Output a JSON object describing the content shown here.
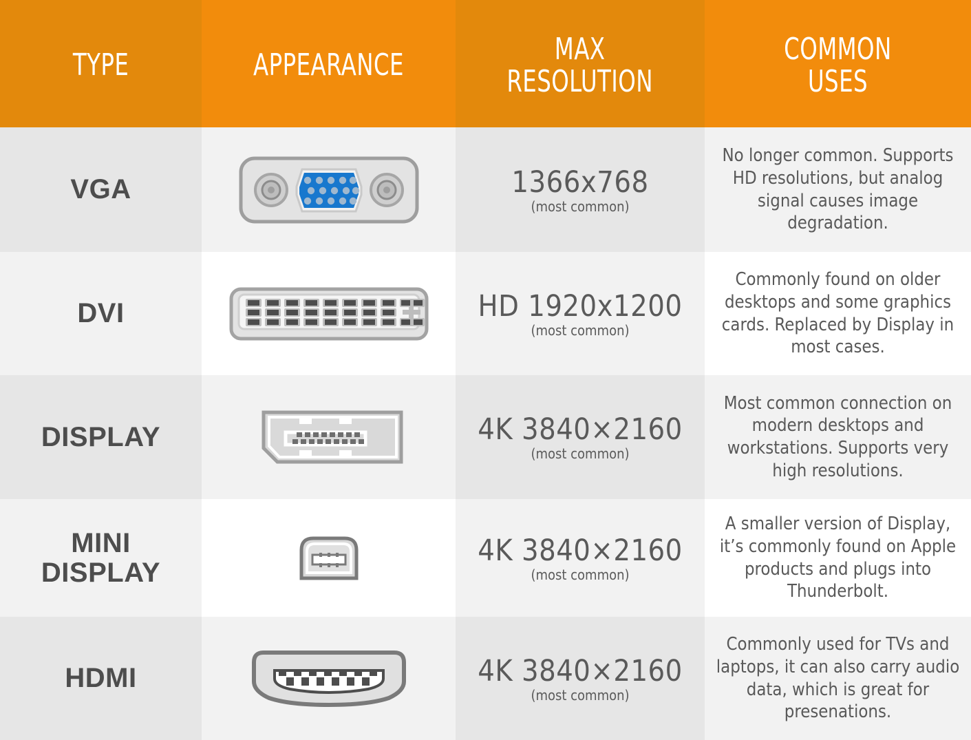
{
  "header": {
    "columns": [
      {
        "label": "TYPE",
        "shade": "dark"
      },
      {
        "label": "APPEARANCE",
        "shade": "bright"
      },
      {
        "label_line1": "MAX",
        "label_line2": "RESOLUTION",
        "shade": "dark"
      },
      {
        "label_line1": "COMMON",
        "label_line2": "USES",
        "shade": "bright"
      }
    ]
  },
  "colors": {
    "header_orange_dark": "#E3890C",
    "header_orange_bright": "#F28C0C",
    "row_shade_a": "#E6E6E6",
    "row_shade_b": "#F2F2F2",
    "row_shade_c": "#FFFFFF",
    "text_gray": "#595959",
    "type_gray": "#4D4D4D",
    "connector_body": "#E0E0E0",
    "connector_outline": "#9A9A9A",
    "connector_pin": "#4D4D4D",
    "vga_blue": "#1878CE"
  },
  "rows": [
    {
      "type": "VGA",
      "connector": "vga-connector",
      "resolution": "1366x768",
      "resolution_note": "(most common)",
      "uses": "No longer common. Supports HD resolutions, but analog signal causes image degradation."
    },
    {
      "type": "DVI",
      "connector": "dvi-connector",
      "resolution": "HD  1920x1200",
      "resolution_note": "(most common)",
      "uses": "Commonly found on older desktops and some graphics cards. Replaced by Display in most cases."
    },
    {
      "type": "DISPLAY",
      "connector": "displayport-connector",
      "resolution": "4K 3840×2160",
      "resolution_note": "(most common)",
      "uses": "Most common connection on modern desktops and workstations. Supports very high resolutions."
    },
    {
      "type_line1": "MINI",
      "type_line2": "DISPLAY",
      "connector": "mini-displayport-connector",
      "resolution": "4K 3840×2160",
      "resolution_note": "(most common)",
      "uses": "A smaller version of Display, it’s commonly found on Apple products and plugs into Thunderbolt."
    },
    {
      "type": "HDMI",
      "connector": "hdmi-connector",
      "resolution": "4K 3840×2160",
      "resolution_note": "(most common)",
      "uses": "Commonly used for TVs and laptops, it can also carry audio data, which is great for presenations."
    }
  ]
}
